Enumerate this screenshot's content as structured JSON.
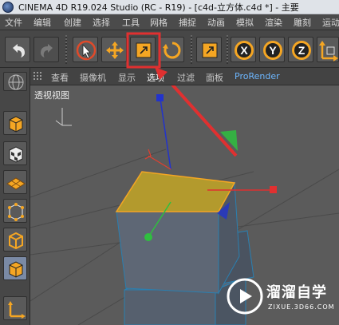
{
  "titlebar": {
    "title": "CINEMA 4D R19.024 Studio (RC - R19) - [c4d-立方体.c4d *] - 主要"
  },
  "menu": [
    "文件",
    "编辑",
    "创建",
    "选择",
    "工具",
    "网格",
    "捕捉",
    "动画",
    "模拟",
    "渲染",
    "雕刻",
    "运动"
  ],
  "toolbar": {
    "undo": "undo-icon",
    "redo": "redo-icon",
    "select": "live-selection-icon",
    "move": "move-icon",
    "scale": "scale-icon",
    "rotate": "rotate-icon",
    "model": "model-mode-icon",
    "x": "X",
    "y": "Y",
    "z": "Z",
    "coord": "coordinate-system-icon"
  },
  "viewport_menu": [
    "查看",
    "摄像机",
    "显示",
    "选项",
    "过滤",
    "面板",
    "ProRender"
  ],
  "viewport_label": "透视视图",
  "watermark": {
    "name": "溜溜自学",
    "url": "ZIXUE.3D66.COM"
  },
  "colors": {
    "highlight_box": "#e03030",
    "selected_face": "#b39a2d",
    "active_tool": "#f5a623"
  }
}
